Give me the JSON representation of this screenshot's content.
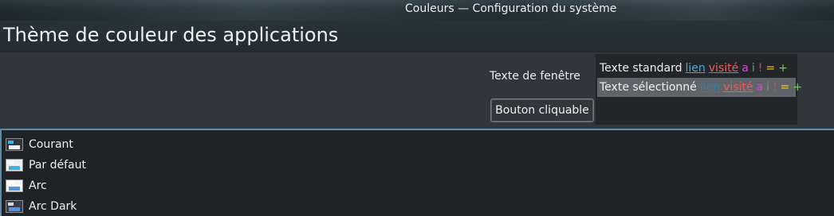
{
  "window": {
    "title": "Couleurs — Configuration du système"
  },
  "header": {
    "title": "Thème de couleur des applications"
  },
  "preview": {
    "window_text_label": "Texte de fenêtre",
    "button_label": "Bouton cliquable",
    "standard_row": {
      "text": "Texte standard",
      "link": "lien",
      "visited": "visité",
      "active": "a",
      "inactive": "i",
      "negative": "!",
      "neutral": "=",
      "positive": "+"
    },
    "selected_row": {
      "text": "Texte sélectionné",
      "link": "lien",
      "visited": "visité",
      "active": "a",
      "inactive": "i",
      "negative": "!",
      "neutral": "=",
      "positive": "+"
    }
  },
  "schemes": [
    {
      "label": "Courant",
      "icon": "color-scheme-swatch-icon",
      "colors": [
        "#31363b",
        "#eff0f1",
        "#3daee9"
      ]
    },
    {
      "label": "Par défaut",
      "icon": "color-scheme-swatch-icon",
      "colors": [
        "#eff0f1",
        "#3daee9",
        "#fcfcfc"
      ]
    },
    {
      "label": "Arc",
      "icon": "color-scheme-swatch-icon",
      "colors": [
        "#f5f6f7",
        "#5294e2",
        "#ffffff"
      ]
    },
    {
      "label": "Arc Dark",
      "icon": "color-scheme-swatch-icon",
      "colors": [
        "#383c4a",
        "#5294e2",
        "#d3dae3"
      ]
    }
  ],
  "colors": {
    "accent": "#5d8aa8",
    "window_bg": "#31363b",
    "view_bg": "#232629",
    "link": "#3daee9",
    "visited": "#e85e5e"
  }
}
